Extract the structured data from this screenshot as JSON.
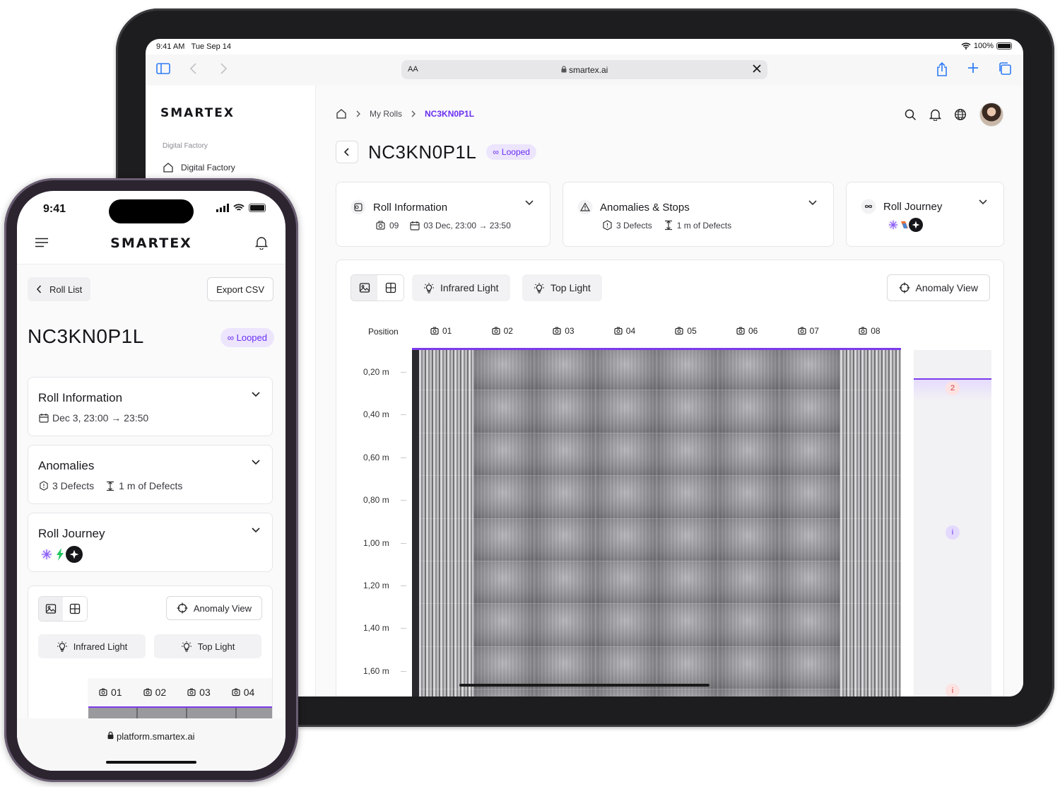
{
  "tablet": {
    "status": {
      "time": "9:41 AM",
      "date": "Tue Sep 14",
      "battery": "100%"
    },
    "browser": {
      "aa": "AA",
      "url": "smartex.ai"
    },
    "sidebar": {
      "logo": "SMARTEX",
      "section": "Digital Factory",
      "nav_item": "Digital Factory"
    },
    "breadcrumb": {
      "parent": "My Rolls",
      "current": "NC3KN0P1L"
    },
    "title": "NC3KN0P1L",
    "badge": "Looped",
    "cards": {
      "roll_info": {
        "title": "Roll Information",
        "count": "09",
        "date": "03 Dec, 23:00 → 23:50"
      },
      "anomalies": {
        "title": "Anomalies & Stops",
        "defects": "3 Defects",
        "length": "1 m of Defects"
      },
      "journey": {
        "title": "Roll Journey"
      }
    },
    "viewer": {
      "infrared_label": "Infrared Light",
      "top_label": "Top Light",
      "anomaly_label": "Anomaly View",
      "position_header": "Position",
      "cameras": [
        "01",
        "02",
        "03",
        "04",
        "05",
        "06",
        "07",
        "08"
      ],
      "positions": [
        "0,20 m",
        "0,40 m",
        "0,60 m",
        "0,80 m",
        "1,00 m",
        "1,20 m",
        "1,40 m",
        "1,60 m"
      ],
      "markers": [
        "2",
        "i",
        "i"
      ]
    }
  },
  "phone": {
    "status": {
      "time": "9:41"
    },
    "logo": "SMARTEX",
    "roll_list_label": "Roll List",
    "export_label": "Export CSV",
    "title": "NC3KN0P1L",
    "badge": "Looped",
    "cards": {
      "roll_info": {
        "title": "Roll Information",
        "date": "Dec 3, 23:00 → 23:50"
      },
      "anomalies": {
        "title": "Anomalies",
        "defects": "3 Defects",
        "length": "1 m of Defects"
      },
      "journey": {
        "title": "Roll Journey"
      }
    },
    "viewer": {
      "anomaly_label": "Anomaly View",
      "infrared_label": "Infrared Light",
      "top_label": "Top Light",
      "cameras": [
        "01",
        "02",
        "03",
        "04"
      ]
    },
    "url": "platform.smartex.ai"
  },
  "colors": {
    "accent": "#6b2ef2",
    "accent_soft": "#ece5fd",
    "browser_blue": "#2f7cf6"
  }
}
